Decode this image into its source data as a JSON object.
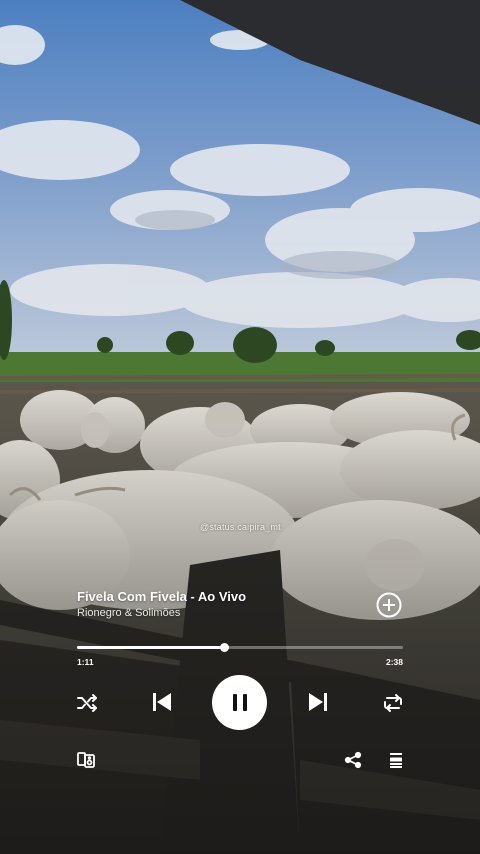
{
  "watermark": "@status.caipira_mt",
  "track": {
    "title": "Fivela Com Fivela - Ao Vivo",
    "artist": "Rionegro & Solimões"
  },
  "player": {
    "elapsed": "1:11",
    "total": "2:38",
    "progress": 0.45,
    "state": "playing"
  },
  "icons": {
    "add": "plus-circle-icon",
    "shuffle": "shuffle-icon",
    "previous": "skip-previous-icon",
    "pause": "pause-icon",
    "next": "skip-next-icon",
    "repeat": "repeat-icon",
    "devices": "connect-device-icon",
    "share": "share-icon",
    "queue": "queue-icon"
  },
  "colors": {
    "accent": "#ffffff",
    "track_bg": "#ffffff59"
  }
}
